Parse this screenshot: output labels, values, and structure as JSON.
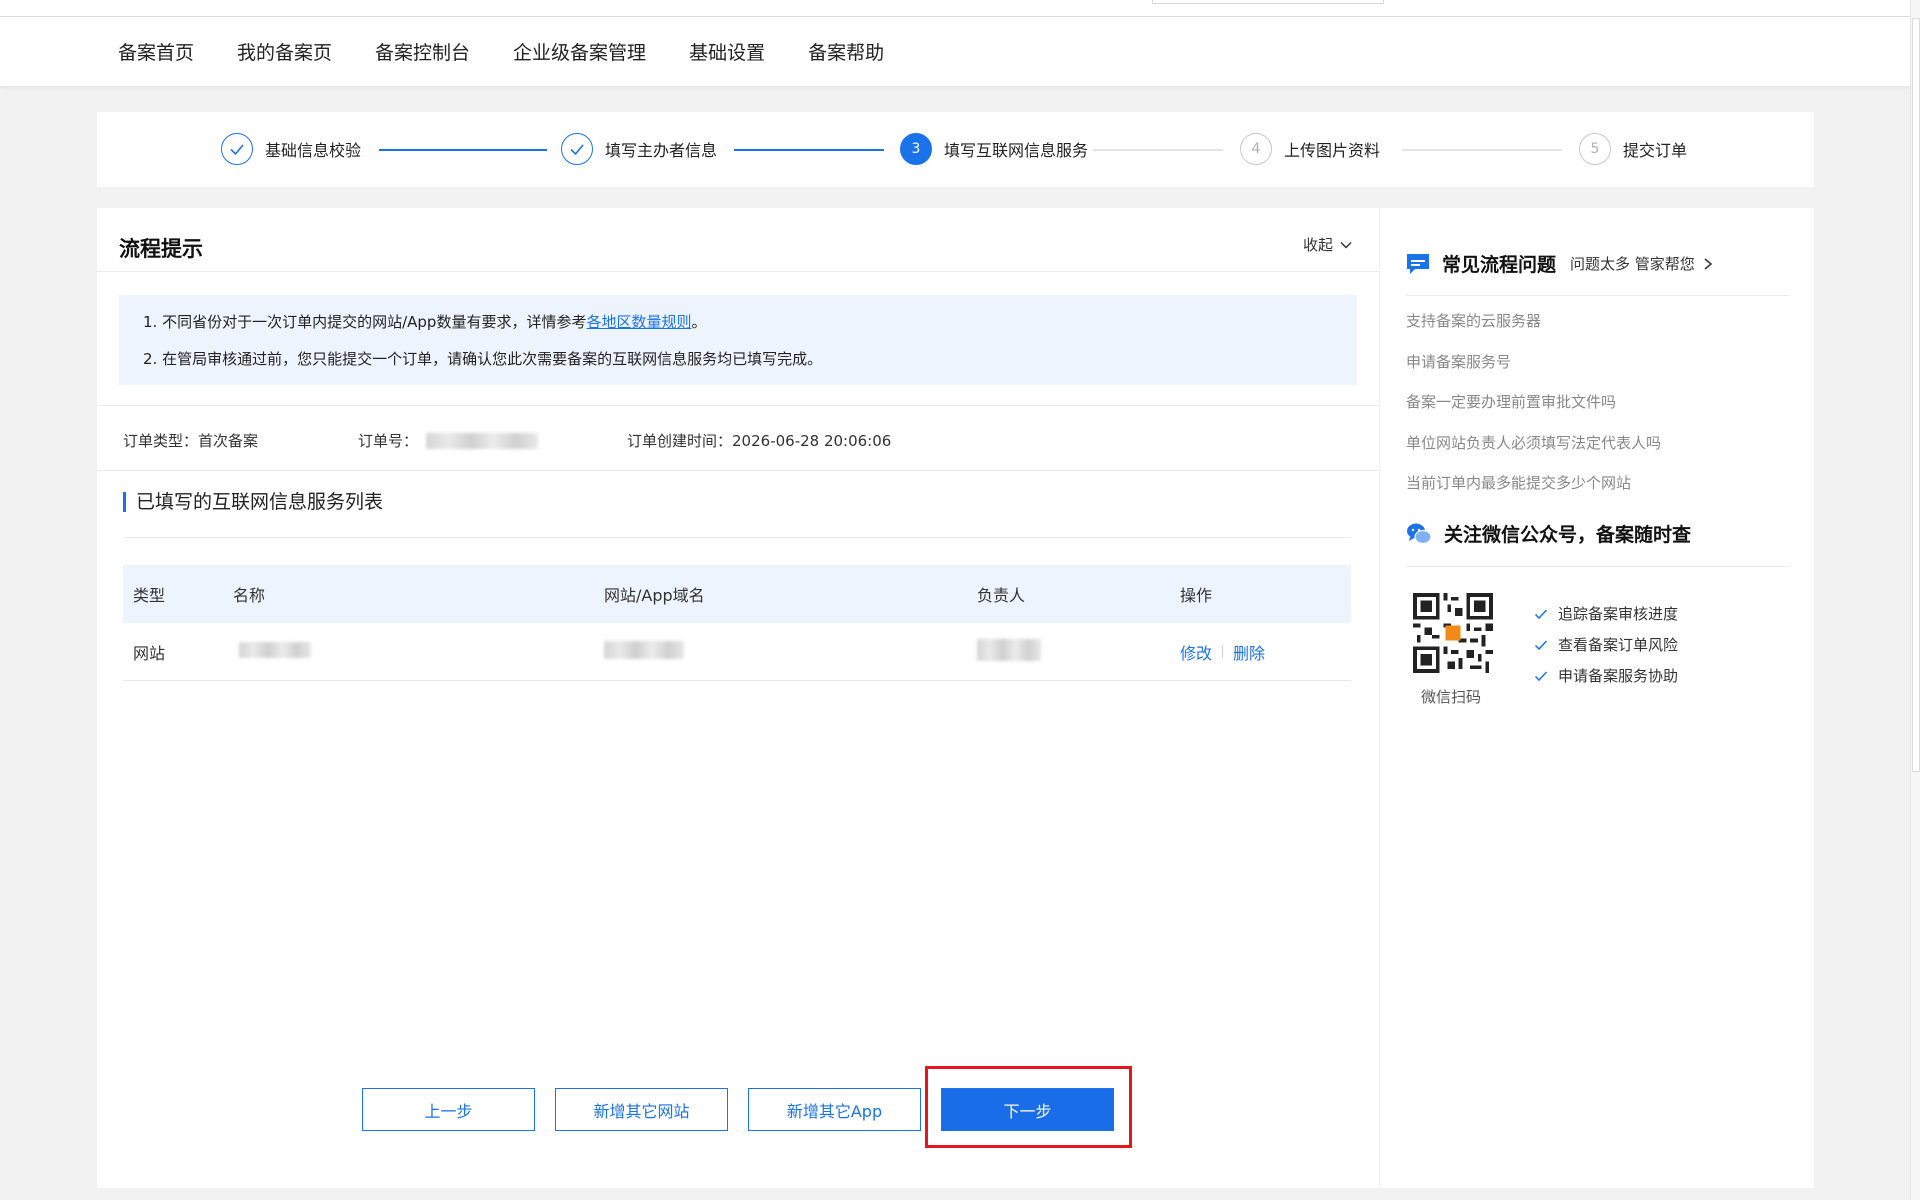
{
  "nav": {
    "items": [
      "备案首页",
      "我的备案页",
      "备案控制台",
      "企业级备案管理",
      "基础设置",
      "备案帮助"
    ]
  },
  "steps": [
    {
      "label": "基础信息校验",
      "status": "done",
      "num": ""
    },
    {
      "label": "填写主办者信息",
      "status": "done",
      "num": ""
    },
    {
      "label": "填写互联网信息服务",
      "status": "active",
      "num": "3"
    },
    {
      "label": "上传图片资料",
      "status": "todo",
      "num": "4"
    },
    {
      "label": "提交订单",
      "status": "todo",
      "num": "5"
    }
  ],
  "flow": {
    "title": "流程提示",
    "collapse_label": "收起",
    "tip1_prefix": "1. 不同省份对于一次订单内提交的网站/App数量有要求，详情参考",
    "tip1_link": "各地区数量规则",
    "tip1_suffix": "。",
    "tip2": "2. 在管局审核通过前，您只能提交一个订单，请确认您此次需要备案的互联网信息服务均已填写完成。"
  },
  "order": {
    "type_label": "订单类型：",
    "type_value": "首次备案",
    "no_label": "订单号：",
    "time_label": "订单创建时间：",
    "time_value": "2026-06-28 20:06:06"
  },
  "list": {
    "title": "已填写的互联网信息服务列表",
    "headers": [
      "类型",
      "名称",
      "网站/App域名",
      "负责人",
      "操作"
    ],
    "rows": [
      {
        "type": "网站",
        "edit": "修改",
        "delete": "删除"
      }
    ]
  },
  "buttons": {
    "prev": "上一步",
    "add_site": "新增其它网站",
    "add_app": "新增其它App",
    "next": "下一步"
  },
  "sidebar": {
    "title": "常见流程问题",
    "subtitle": "问题太多 管家帮您",
    "questions": [
      "支持备案的云服务器",
      "申请备案服务号",
      "备案一定要办理前置审批文件吗",
      "单位网站负责人必须填写法定代表人吗",
      "当前订单内最多能提交多少个网站"
    ],
    "wechat_title": "关注微信公众号，备案随时查",
    "qr_label": "微信扫码",
    "features": [
      "追踪备案审核进度",
      "查看备案订单风险",
      "申请备案服务协助"
    ]
  },
  "colors": {
    "accent": "#1a73e8",
    "highlight": "#e5161d",
    "tip_bg": "#eef4fd"
  }
}
